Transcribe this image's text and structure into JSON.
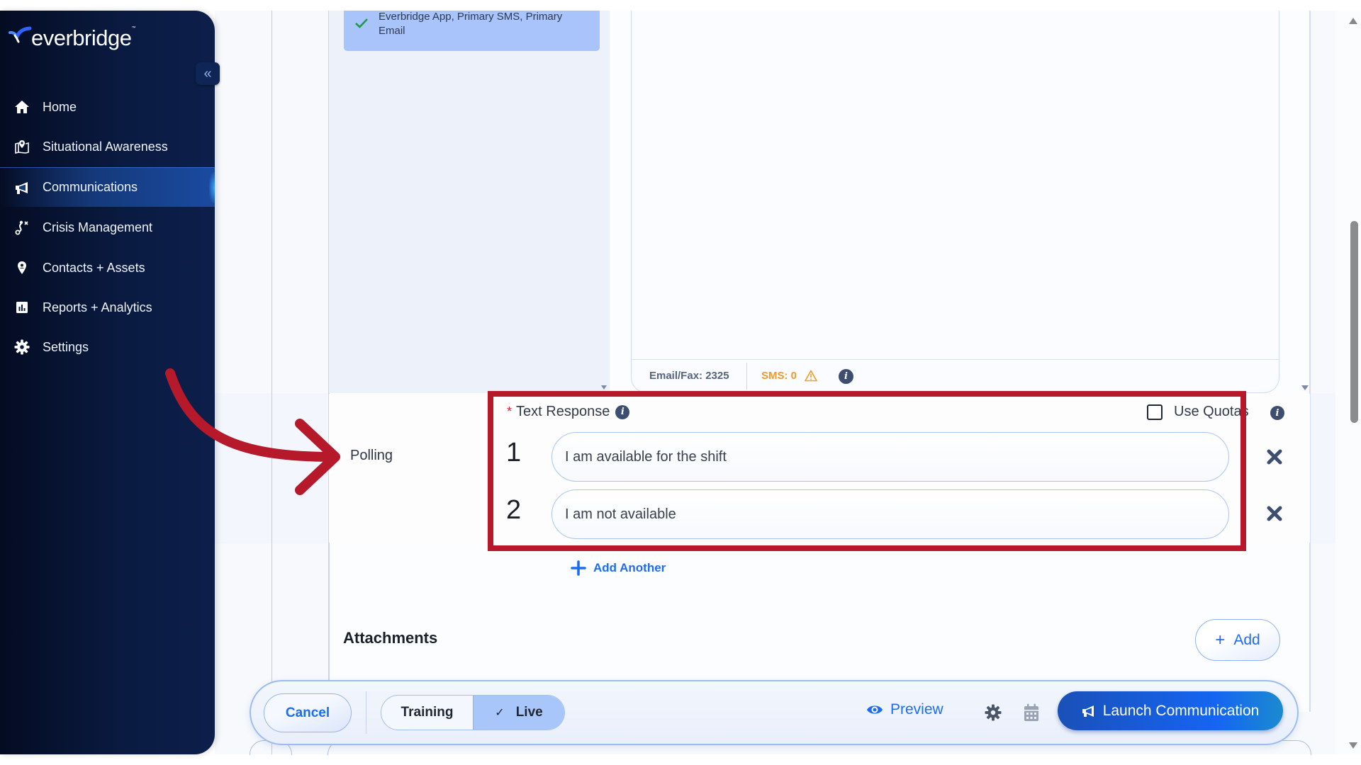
{
  "brand": {
    "logo_text": "everbridge",
    "logo_tm": "™",
    "accent_color": "#1d6df0",
    "highlight_color": "#b5192a"
  },
  "sidebar": {
    "collapse_icon": "double-chevron-left-icon",
    "collapse_glyph": "«",
    "items": [
      {
        "label": "Home",
        "icon": "home-icon",
        "active": false
      },
      {
        "label": "Situational Awareness",
        "icon": "map-pin-icon",
        "active": false
      },
      {
        "label": "Communications",
        "icon": "megaphone-icon",
        "active": true
      },
      {
        "label": "Crisis Management",
        "icon": "route-icon",
        "active": false
      },
      {
        "label": "Contacts + Assets",
        "icon": "location-pin-icon",
        "active": false
      },
      {
        "label": "Reports + Analytics",
        "icon": "bar-chart-icon",
        "active": false
      },
      {
        "label": "Settings",
        "icon": "gear-icon",
        "active": false
      }
    ]
  },
  "channels": {
    "selected_text": "Everbridge App, Primary SMS, Primary Email",
    "status_icon": "check-icon"
  },
  "message": {
    "email_fax_count": "Email/Fax: 2325",
    "sms_count": "SMS: 0",
    "sms_warning_icon": "warning-triangle-icon",
    "info_icon": "info-icon"
  },
  "polling": {
    "section_label": "Polling",
    "required_marker": "*",
    "field_label": "Text Response",
    "use_quotas_label": "Use Quotas",
    "use_quotas_checked": false,
    "responses": [
      {
        "number": "1",
        "value": "I am available for the shift"
      },
      {
        "number": "2",
        "value": "I am not available"
      }
    ],
    "add_another_label": "Add Another"
  },
  "attachments": {
    "title": "Attachments",
    "add_label": "Add",
    "add_glyph": "+"
  },
  "action_bar": {
    "cancel_label": "Cancel",
    "mode_options": [
      "Training",
      "Live"
    ],
    "mode_selected": "Live",
    "check_glyph": "✓",
    "preview_label": "Preview",
    "settings_icon": "gear-icon",
    "schedule_icon": "calendar-icon",
    "launch_label": "Launch Communication"
  },
  "scrollbar": {
    "position_fraction": 0.38
  }
}
